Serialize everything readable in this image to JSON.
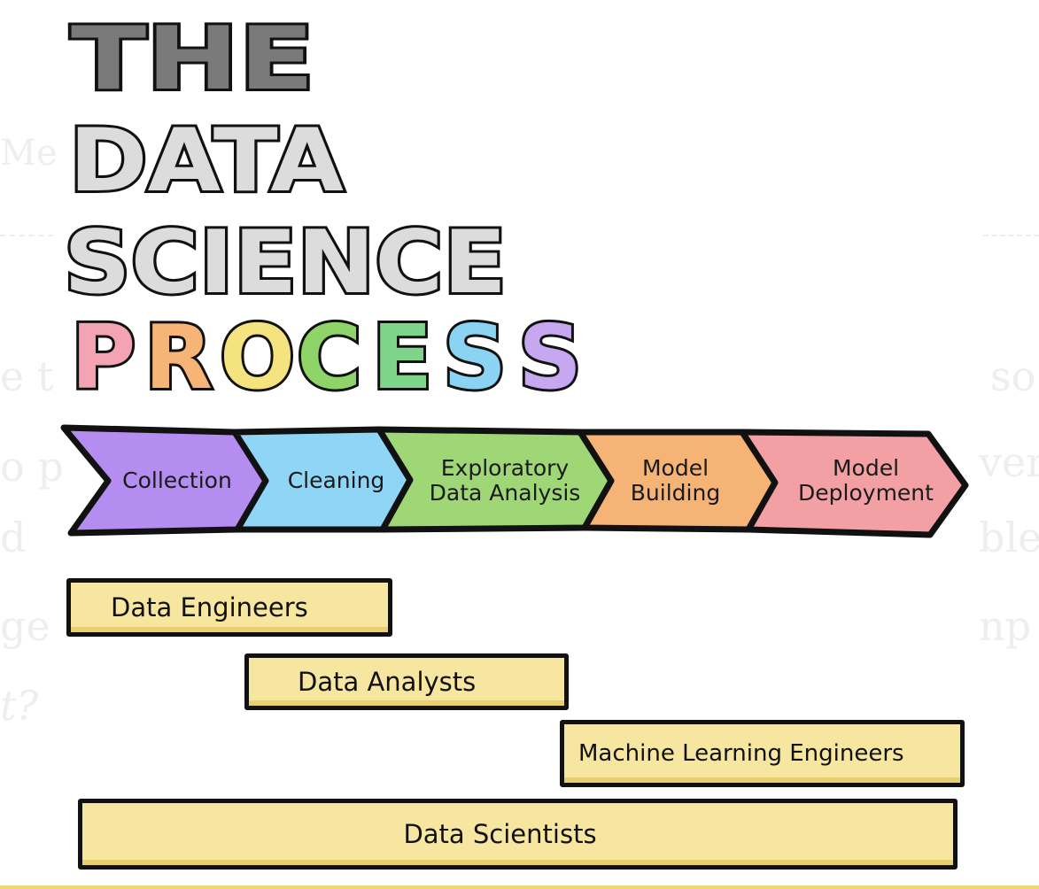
{
  "title": {
    "line1": "THE",
    "line2": "DATA",
    "line3": "SCIENCE",
    "line4_letters": [
      {
        "char": "P",
        "color": "#f3a3b2"
      },
      {
        "char": "R",
        "color": "#f6b576"
      },
      {
        "char": "O",
        "color": "#f5e37f"
      },
      {
        "char": "C",
        "color": "#8fd468"
      },
      {
        "char": "E",
        "color": "#7fd48c"
      },
      {
        "char": "S",
        "color": "#8ad3f2"
      },
      {
        "char": "S",
        "color": "#c7a8f0"
      }
    ]
  },
  "stages": [
    {
      "label": "Collection",
      "color": "#b58df0"
    },
    {
      "label": "Cleaning",
      "color": "#8fd6f6"
    },
    {
      "label": "Exploratory\nData Analysis",
      "color": "#9fd776"
    },
    {
      "label": "Model\nBuilding",
      "color": "#f5b475"
    },
    {
      "label": "Model\nDeployment",
      "color": "#f2a0a4"
    }
  ],
  "roles": [
    {
      "label": "Data Engineers"
    },
    {
      "label": "Data Analysts"
    },
    {
      "label": "Machine Learning Engineers"
    },
    {
      "label": "Data Scientists"
    }
  ],
  "colors": {
    "outline": "#111111",
    "title_gray_dark": "#7a7a7a",
    "title_gray_light": "#dcdcdc",
    "role_fill": "#f7e6a0"
  }
}
